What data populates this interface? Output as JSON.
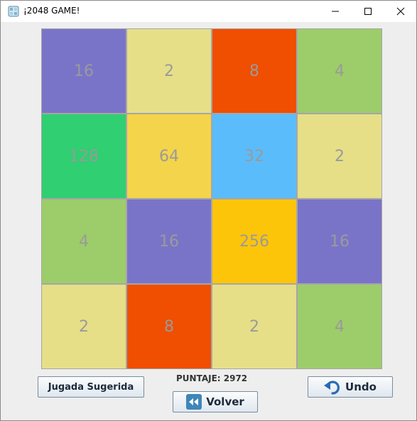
{
  "window": {
    "title": "¡2048 GAME!",
    "icon": "app-dice-icon"
  },
  "board": {
    "tiles": [
      {
        "value": "16",
        "color": "#7a74c9"
      },
      {
        "value": "2",
        "color": "#e6df88"
      },
      {
        "value": "8",
        "color": "#f04e00"
      },
      {
        "value": "4",
        "color": "#9ccd6a"
      },
      {
        "value": "128",
        "color": "#2fcf72"
      },
      {
        "value": "64",
        "color": "#f4d44a"
      },
      {
        "value": "32",
        "color": "#5bbcfb"
      },
      {
        "value": "2",
        "color": "#e6df88"
      },
      {
        "value": "4",
        "color": "#9ccd6a"
      },
      {
        "value": "16",
        "color": "#7a74c9"
      },
      {
        "value": "256",
        "color": "#fdc50a"
      },
      {
        "value": "16",
        "color": "#7a74c9"
      },
      {
        "value": "2",
        "color": "#e6df88"
      },
      {
        "value": "8",
        "color": "#f04e00"
      },
      {
        "value": "2",
        "color": "#e6df88"
      },
      {
        "value": "4",
        "color": "#9ccd6a"
      }
    ]
  },
  "controls": {
    "suggest_label": "Jugada Sugerida",
    "score_label": "PUNTAJE: 2972",
    "undo_label": "Undo",
    "back_label": "Volver"
  }
}
